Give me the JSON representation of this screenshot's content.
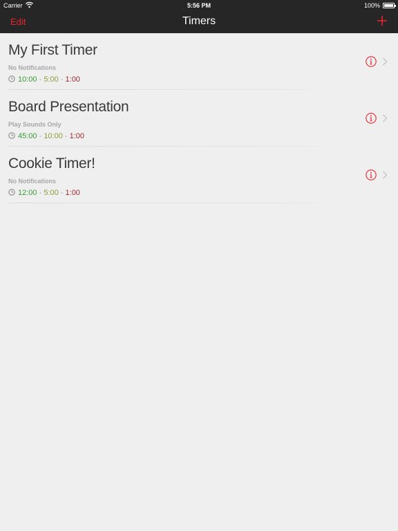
{
  "status_bar": {
    "carrier": "Carrier",
    "time": "5:56 PM",
    "battery": "100%"
  },
  "nav": {
    "edit_label": "Edit",
    "title": "Timers"
  },
  "timers": [
    {
      "name": "My First Timer",
      "notifications": "No Notifications",
      "t1": "10:00",
      "sep1": " - ",
      "t2": "5:00",
      "sep2": " - ",
      "t3": "1:00"
    },
    {
      "name": "Board Presentation",
      "notifications": "Play Sounds Only",
      "t1": "45:00",
      "sep1": " - ",
      "t2": "10:00",
      "sep2": " - ",
      "t3": "1:00"
    },
    {
      "name": "Cookie Timer!",
      "notifications": "No Notifications",
      "t1": "12:00",
      "sep1": " - ",
      "t2": "5:00",
      "sep2": " - ",
      "t3": "1:00"
    }
  ],
  "colors": {
    "accent": "#e8252f",
    "green": "#3a9a34",
    "yellow": "#8d9a3a",
    "red": "#9b2a2d",
    "bar": "#262626",
    "background": "#efefef"
  }
}
